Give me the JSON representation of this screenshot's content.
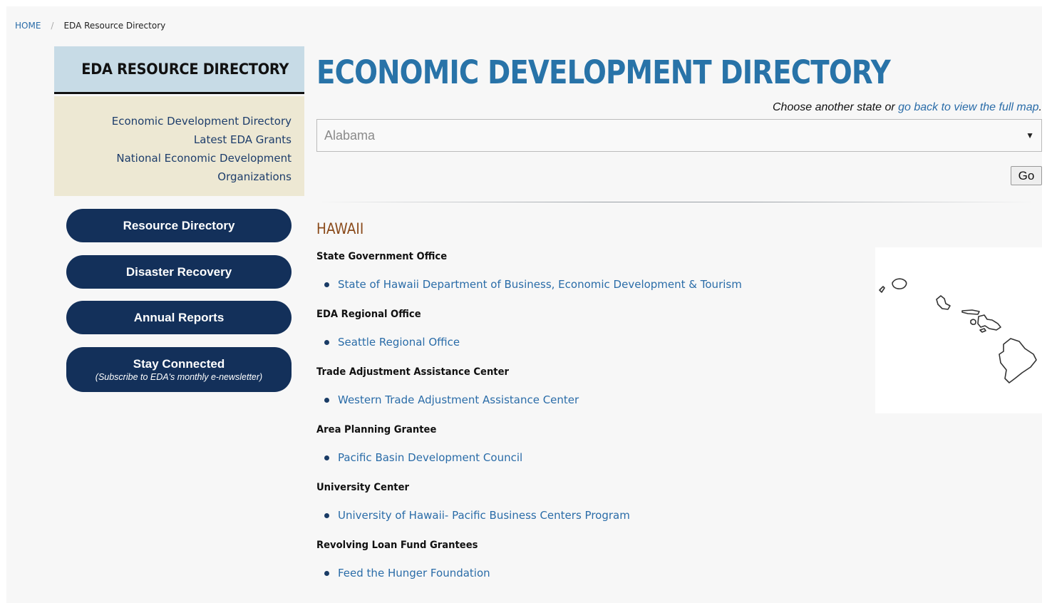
{
  "breadcrumb": {
    "home": "HOME",
    "separator": "/",
    "current": "EDA Resource Directory"
  },
  "sidebar": {
    "header": "EDA RESOURCE DIRECTORY",
    "links": [
      "Economic Development Directory",
      "Latest EDA Grants",
      "National Economic Development",
      "Organizations"
    ],
    "buttons": {
      "resource_directory": "Resource Directory",
      "disaster_recovery": "Disaster Recovery",
      "annual_reports": "Annual Reports",
      "stay_connected": "Stay Connected",
      "stay_connected_sub": "(Subscribe to EDA's monthly e-newsletter)"
    }
  },
  "main": {
    "title": "ECONOMIC DEVELOPMENT DIRECTORY",
    "choose_text": "Choose another state or ",
    "choose_link": "go back to view the full map",
    "choose_end": ".",
    "select_value": "Alabama",
    "go_label": "Go",
    "state_name": "HAWAII",
    "sections": [
      {
        "heading": "State Government Office",
        "item": "State of Hawaii Department of Business, Economic Development & Tourism"
      },
      {
        "heading": "EDA Regional Office",
        "item": "Seattle Regional Office"
      },
      {
        "heading": "Trade Adjustment Assistance Center",
        "item": "Western Trade Adjustment Assistance Center"
      },
      {
        "heading": "Area Planning Grantee",
        "item": "Pacific Basin Development Council"
      },
      {
        "heading": "University Center",
        "item": "University of Hawaii- Pacific Business Centers Program"
      },
      {
        "heading": "Revolving Loan Fund Grantees",
        "item": "Feed the Hunger Foundation"
      }
    ]
  },
  "icons": {
    "select_caret": "▼",
    "bullet": "•",
    "state_map": "hawaii-map-icon"
  }
}
